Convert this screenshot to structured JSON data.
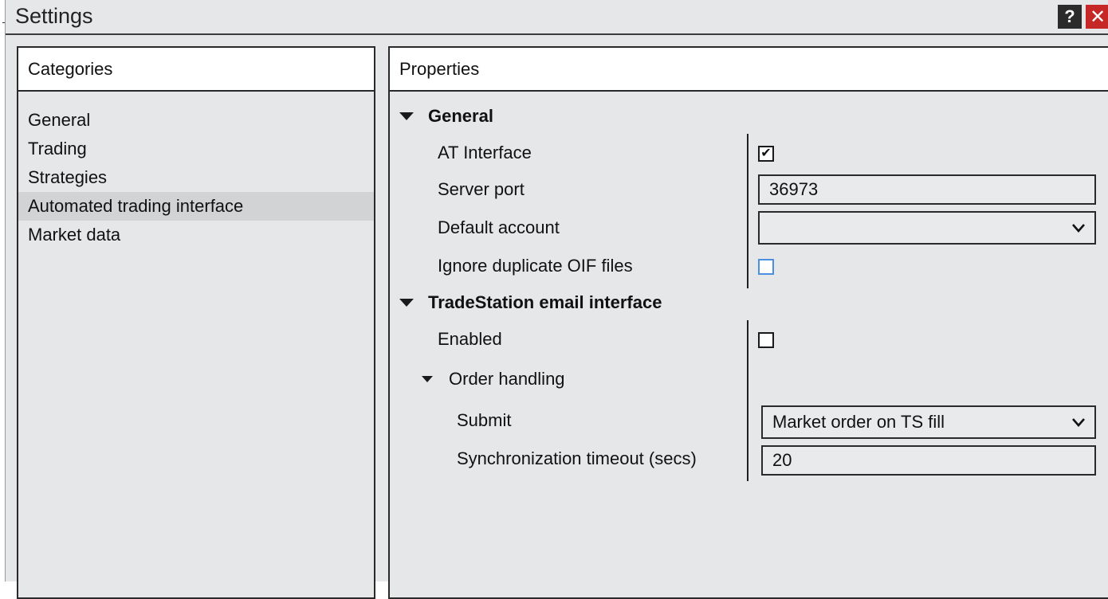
{
  "window": {
    "title": "Settings",
    "help_label": "?",
    "close_label": "✕"
  },
  "categories": {
    "header": "Categories",
    "items": [
      {
        "label": "General"
      },
      {
        "label": "Trading"
      },
      {
        "label": "Strategies"
      },
      {
        "label": "Automated trading interface",
        "selected": true
      },
      {
        "label": "Market data"
      }
    ]
  },
  "properties": {
    "header": "Properties",
    "general": {
      "title": "General",
      "at_interface": {
        "label": "AT Interface",
        "checked": true,
        "check_glyph": "✔"
      },
      "server_port": {
        "label": "Server port",
        "value": "36973"
      },
      "default_account": {
        "label": "Default account",
        "value": ""
      },
      "ignore_duplicate": {
        "label": "Ignore duplicate OIF files",
        "checked": false
      }
    },
    "tradestation": {
      "title": "TradeStation email interface",
      "enabled": {
        "label": "Enabled",
        "checked": false
      },
      "order_handling": {
        "title": "Order handling",
        "submit": {
          "label": "Submit",
          "value": "Market order on TS fill"
        },
        "sync_timeout": {
          "label": "Synchronization timeout (secs)",
          "value": "20"
        }
      }
    }
  },
  "colors": {
    "window_bg": "#e6e7e9",
    "selected_bg": "#d2d3d5",
    "close_red": "#c62828",
    "focus_blue": "#4a90e2"
  }
}
